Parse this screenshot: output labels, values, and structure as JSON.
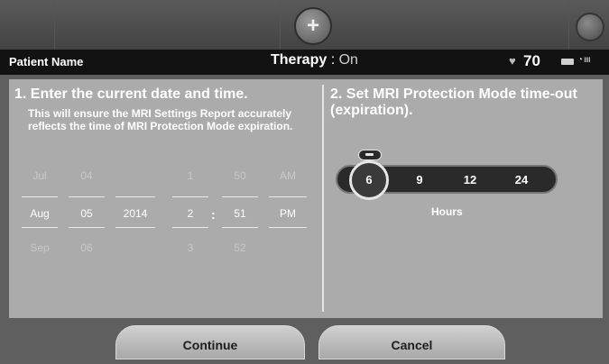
{
  "header": {
    "plus_icon": "plus-circle-icon",
    "right_icon": "device-icon"
  },
  "status": {
    "patient_label": "Patient Name",
    "therapy_label": "Therapy",
    "therapy_sep": " : ",
    "therapy_value": "On",
    "heart_icon": "heart-icon",
    "heart_rate": "70",
    "battery_icon": "battery-icon",
    "signal_icon": "signal-icon"
  },
  "left": {
    "title": "1. Enter the current date and time.",
    "subtitle": "This will ensure the MRI Settings Report accurately reflects the time of MRI Protection Mode expiration.",
    "colon": ":",
    "pickers": {
      "month": {
        "prev": "Jul",
        "cur": "Aug",
        "next": "Sep"
      },
      "day": {
        "prev": "04",
        "cur": "05",
        "next": "06"
      },
      "year": {
        "prev": "",
        "cur": "2014",
        "next": ""
      },
      "hour": {
        "prev": "1",
        "cur": "2",
        "next": "3"
      },
      "minute": {
        "prev": "50",
        "cur": "51",
        "next": "52"
      },
      "ampm": {
        "prev": "AM",
        "cur": "PM",
        "next": ""
      }
    }
  },
  "right": {
    "title": "2. Set MRI Protection Mode time-out (expiration).",
    "options": [
      "6",
      "9",
      "12",
      "24"
    ],
    "selected": "6",
    "unit": "Hours"
  },
  "buttons": {
    "continue": "Continue",
    "cancel": "Cancel"
  }
}
